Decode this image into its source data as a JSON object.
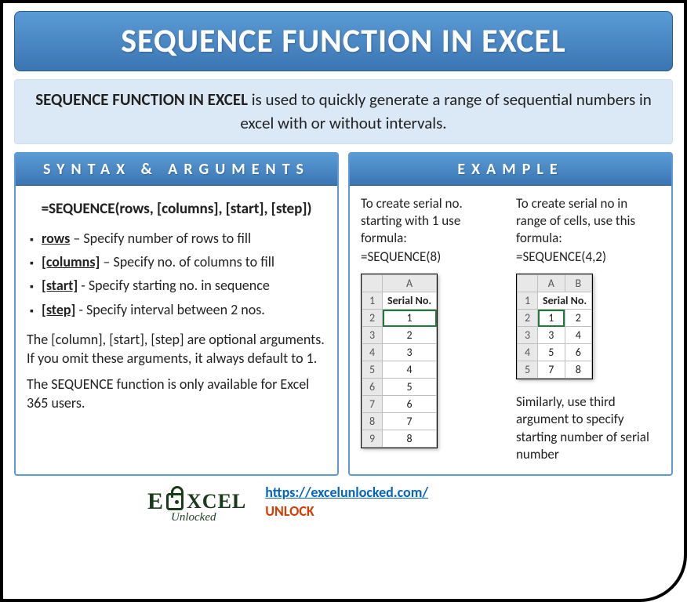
{
  "title": "SEQUENCE FUNCTION IN EXCEL",
  "intro": {
    "lead": "SEQUENCE FUNCTION IN EXCEL",
    "rest": " is used to quickly generate a range of sequential numbers in excel with or without intervals."
  },
  "syntax": {
    "header": "SYNTAX & ARGUMENTS",
    "formula": "=SEQUENCE(rows, [columns], [start], [step])",
    "args": [
      {
        "name": "rows",
        "desc": " – Specify number of rows to fill"
      },
      {
        "name": "[columns]",
        "desc": " – Specify no. of columns to fill"
      },
      {
        "name": "[start]",
        "desc": " - Specify starting no. in sequence"
      },
      {
        "name": "[step]",
        "desc": " - Specify interval between 2  nos."
      }
    ],
    "note1": "The [column], [start], [step] are optional arguments. If you omit these arguments, it always default to 1.",
    "note2": "The SEQUENCE function is only available for Excel 365 users."
  },
  "example": {
    "header": "EXAMPLE",
    "left": {
      "text": "To create serial no. starting with 1 use formula:",
      "formula": "=SEQUENCE(8)",
      "colheaders": [
        "A"
      ],
      "header_label": "Serial No.",
      "rows": [
        "1",
        "2",
        "3",
        "4",
        "5",
        "6",
        "7",
        "8"
      ]
    },
    "right": {
      "text": "To create serial no in range of cells, use this formula:",
      "formula": "=SEQUENCE(4,2)",
      "colheaders": [
        "A",
        "B"
      ],
      "header_label": "Serial No.",
      "rows": [
        [
          "1",
          "2"
        ],
        [
          "3",
          "4"
        ],
        [
          "5",
          "6"
        ],
        [
          "7",
          "8"
        ]
      ],
      "after": "Similarly, use third argument to specify starting number of serial number"
    }
  },
  "footer": {
    "logo_top": "E",
    "logo_rest": "XCEL",
    "logo_sub": "Unlocked",
    "url": "https://excelunlocked.com/",
    "tag": "UNLOCK"
  }
}
